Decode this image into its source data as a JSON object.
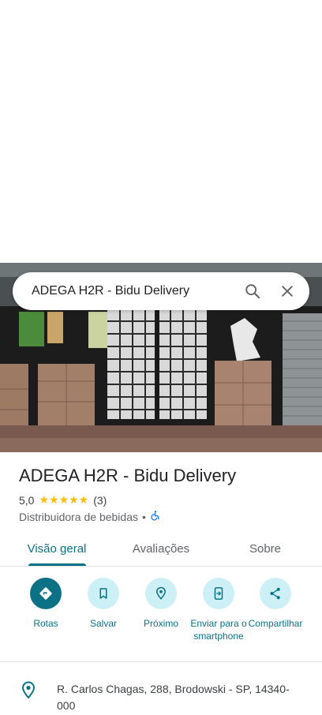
{
  "search": {
    "query": "ADEGA H2R - Bidu Delivery"
  },
  "place": {
    "title": "ADEGA H2R - Bidu Delivery",
    "rating": "5,0",
    "stars": "★★★★★",
    "review_count": "(3)",
    "category": "Distribuidora de bebidas",
    "separator": "•",
    "accessibility_icon": "wheelchair-icon"
  },
  "tabs": [
    {
      "label": "Visão geral",
      "active": true
    },
    {
      "label": "Avaliações",
      "active": false
    },
    {
      "label": "Sobre",
      "active": false
    }
  ],
  "actions": [
    {
      "label": "Rotas",
      "icon": "directions-icon"
    },
    {
      "label": "Salvar",
      "icon": "bookmark-icon"
    },
    {
      "label": "Próximo",
      "icon": "nearby-icon"
    },
    {
      "label": "Enviar para o smartphone",
      "icon": "send-to-phone-icon"
    },
    {
      "label": "Compartilhar",
      "icon": "share-icon"
    }
  ],
  "address": {
    "text": "R. Carlos Chagas, 288, Brodowski - SP, 14340-000"
  },
  "colors": {
    "accent": "#0b7285",
    "accent_light": "#cdeff6",
    "star": "#fbbc04"
  }
}
